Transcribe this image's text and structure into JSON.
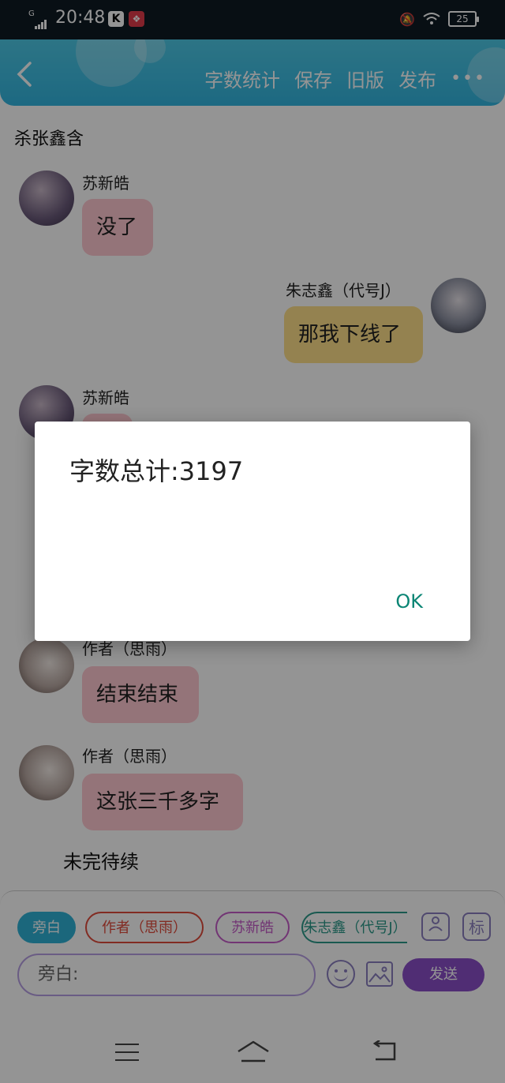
{
  "status_bar": {
    "network": "G",
    "time": "20:48",
    "app_badge": "K",
    "battery": "25"
  },
  "header": {
    "actions": [
      "字数统计",
      "保存",
      "旧版",
      "发布"
    ],
    "more": "•••"
  },
  "chat": {
    "title": "杀张鑫含",
    "messages": [
      {
        "speaker": "苏新皓",
        "text": "没了",
        "side": "left",
        "bubble_color": "#ffc8d0"
      },
      {
        "speaker": "朱志鑫（代号J）",
        "text": "那我下线了",
        "side": "right",
        "bubble_color": "#ffe08a"
      },
      {
        "speaker": "苏新皓",
        "text": "",
        "side": "left",
        "bubble_color": "#ffc8d0"
      },
      {
        "speaker": "作者（思雨）",
        "text": "结束结束",
        "side": "left",
        "bubble_color": "#ffc8d0"
      },
      {
        "speaker": "作者（思雨）",
        "text": "这张三千多字",
        "side": "left",
        "bubble_color": "#ffc8d0"
      }
    ],
    "narration": "未完待续"
  },
  "composer": {
    "chips": [
      {
        "label": "旁白",
        "color": "#2fb2d6",
        "filled": true
      },
      {
        "label": "作者（思雨）",
        "color": "#e04b3c",
        "filled": false
      },
      {
        "label": "苏新皓",
        "color": "#c55cc9",
        "filled": false
      },
      {
        "label": "朱志鑫（代号J）",
        "color": "#2c9a8a",
        "filled": false
      }
    ],
    "tag_button": "标",
    "input_placeholder": "旁白:",
    "send_label": "发送"
  },
  "dialog": {
    "message": "字数总计:3197",
    "ok_label": "OK"
  }
}
